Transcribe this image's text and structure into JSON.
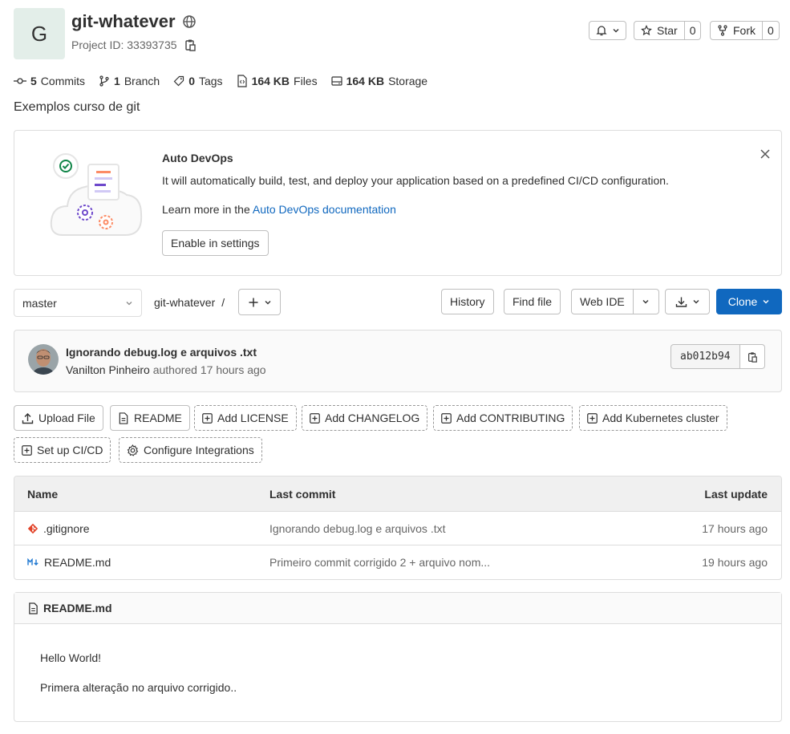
{
  "project": {
    "avatar_letter": "G",
    "name": "git-whatever",
    "id_label": "Project ID: 33393735",
    "description": "Exemplos curso de git"
  },
  "actions": {
    "star_label": "Star",
    "star_count": "0",
    "fork_label": "Fork",
    "fork_count": "0"
  },
  "stats": [
    {
      "icon": "commit-icon",
      "value": "5",
      "label": "Commits"
    },
    {
      "icon": "branch-icon",
      "value": "1",
      "label": "Branch"
    },
    {
      "icon": "tag-icon",
      "value": "0",
      "label": "Tags"
    },
    {
      "icon": "file-icon",
      "value": "164 KB",
      "label": "Files"
    },
    {
      "icon": "storage-icon",
      "value": "164 KB",
      "label": "Storage"
    }
  ],
  "autodevops": {
    "title": "Auto DevOps",
    "text": "It will automatically build, test, and deploy your application based on a predefined CI/CD configuration.",
    "learn_prefix": "Learn more in the",
    "learn_link": "Auto DevOps documentation",
    "button": "Enable in settings"
  },
  "toolbar": {
    "branch": "master",
    "path_root": "git-whatever",
    "separator": "/",
    "history": "History",
    "find_file": "Find file",
    "web_ide": "Web IDE",
    "clone": "Clone"
  },
  "last_commit": {
    "title": "Ignorando debug.log e arquivos .txt",
    "author": "Vanilton Pinheiro",
    "authored": "authored 17 hours ago",
    "sha": "ab012b94"
  },
  "quick_actions": [
    "Upload File",
    "README",
    "Add LICENSE",
    "Add CHANGELOG",
    "Add CONTRIBUTING",
    "Add Kubernetes cluster",
    "Set up CI/CD",
    "Configure Integrations"
  ],
  "files": {
    "headers": [
      "Name",
      "Last commit",
      "Last update"
    ],
    "rows": [
      {
        "name": ".gitignore",
        "commit": "Ignorando debug.log e arquivos .txt",
        "updated": "17 hours ago"
      },
      {
        "name": "README.md",
        "commit": "Primeiro commit corrigido 2 + arquivo nom...",
        "updated": "19 hours ago"
      }
    ]
  },
  "readme": {
    "filename": "README.md",
    "line1": "Hello World!",
    "line2": "Primera alteração no arquivo corrigido.."
  },
  "colors": {
    "primary": "#1068bf",
    "link": "#1068bf",
    "git_orange": "#e24329"
  }
}
